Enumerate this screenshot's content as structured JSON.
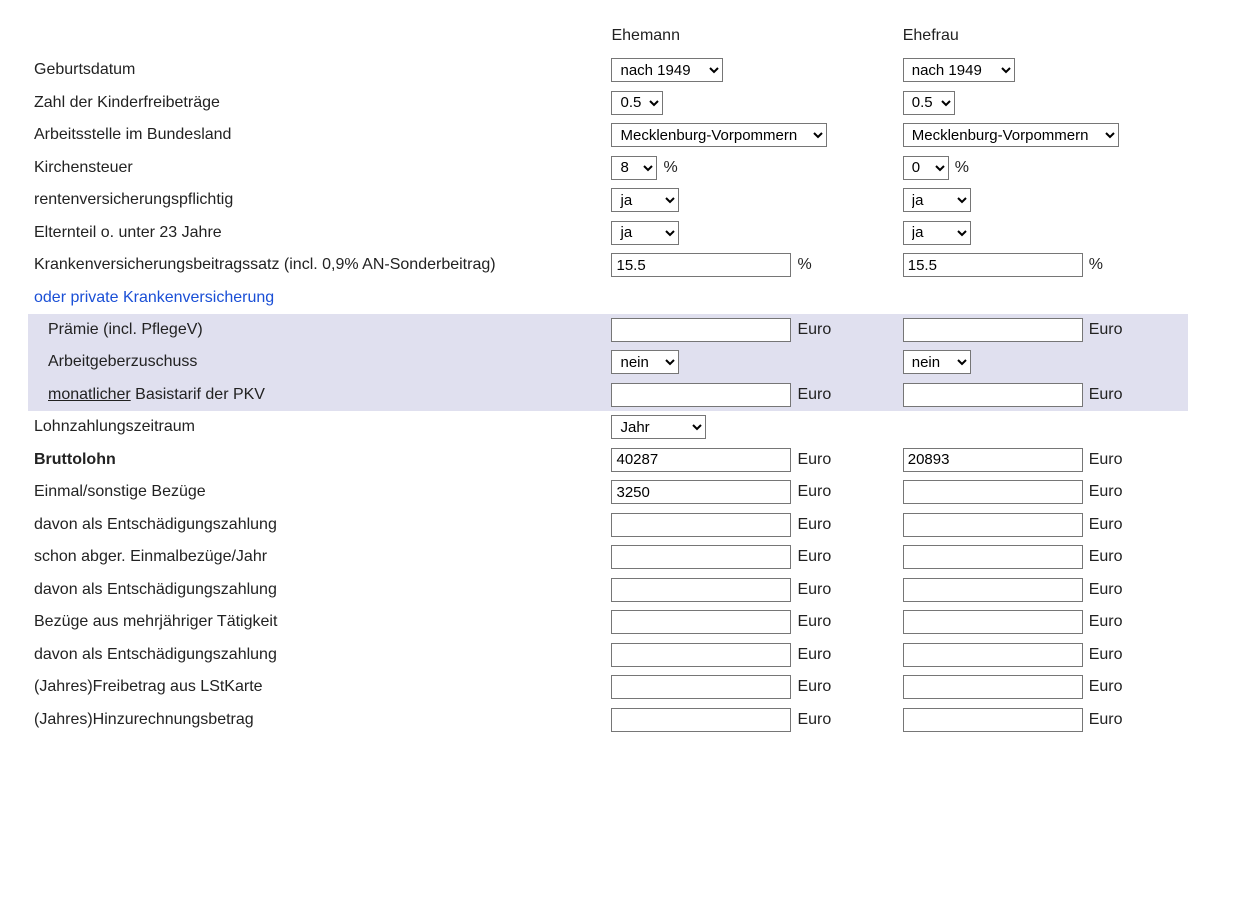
{
  "headers": {
    "husband": "Ehemann",
    "wife": "Ehefrau"
  },
  "units": {
    "percent": "%",
    "euro": "Euro"
  },
  "labels": {
    "birthdate": "Geburtsdatum",
    "child_allowances": "Zahl der Kinderfreibeträge",
    "work_state": "Arbeitsstelle im Bundesland",
    "church_tax": "Kirchensteuer",
    "pension_mandatory": "rentenversicherungspflichtig",
    "parent_or_under23": "Elternteil o. unter 23 Jahre",
    "kv_rate": "Krankenversicherungsbeitragssatz   (incl. 0,9% AN-Sonderbeitrag)",
    "or_private_kv": "oder private Krankenversicherung",
    "premium": "Prämie (incl. PflegeV)",
    "employer_subsidy": "Arbeitgeberzuschuss",
    "monthly_prefix": "monatlicher",
    "monthly_suffix": " Basistarif der PKV",
    "pay_period": "Lohnzahlungszeitraum",
    "gross": "Bruttolohn",
    "one_time": "Einmal/sonstige Bezüge",
    "thereof_comp1": "davon als Entschädigungszahlung",
    "already_taxed": "schon abger. Einmalbezüge/Jahr",
    "thereof_comp2": "davon als Entschädigungszahlung",
    "multi_year": "Bezüge aus mehrjähriger Tätigkeit",
    "thereof_comp3": "davon als Entschädigungszahlung",
    "allowance_card": "(Jahres)Freibetrag aus LStKarte",
    "add_amount": "(Jahres)Hinzurechnungsbetrag"
  },
  "husband": {
    "birthdate": "nach 1949",
    "child_allowances": "0.5",
    "work_state": "Mecklenburg-Vorpommern",
    "church_tax": "8",
    "pension_mandatory": "ja",
    "parent_or_under23": "ja",
    "kv_rate": "15.5",
    "premium": "",
    "employer_subsidy": "nein",
    "monthly_base": "",
    "pay_period": "Jahr",
    "gross": "40287",
    "one_time": "3250",
    "thereof_comp1": "",
    "already_taxed": "",
    "thereof_comp2": "",
    "multi_year": "",
    "thereof_comp3": "",
    "allowance_card": "",
    "add_amount": ""
  },
  "wife": {
    "birthdate": "nach 1949",
    "child_allowances": "0.5",
    "work_state": "Mecklenburg-Vorpommern",
    "church_tax": "0",
    "pension_mandatory": "ja",
    "parent_or_under23": "ja",
    "kv_rate": "15.5",
    "premium": "",
    "employer_subsidy": "nein",
    "monthly_base": "",
    "gross": "20893",
    "one_time": "",
    "thereof_comp1": "",
    "already_taxed": "",
    "thereof_comp2": "",
    "multi_year": "",
    "thereof_comp3": "",
    "allowance_card": "",
    "add_amount": ""
  }
}
